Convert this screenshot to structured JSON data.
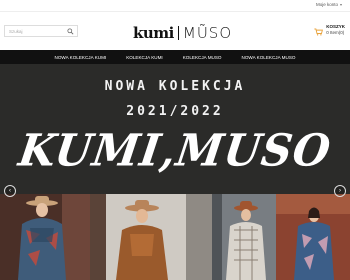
{
  "topbar": {
    "account_label": "Moje konto",
    "caret": "▾"
  },
  "header": {
    "search": {
      "placeholder": "Szukaj",
      "value": ""
    },
    "logo": {
      "left": "kumi",
      "right": "MŨSO"
    },
    "cart": {
      "title": "KOSZYK",
      "items": "0 Item(0)"
    }
  },
  "nav": {
    "items": [
      {
        "label": "NOWA KOLEKCJA KUMI"
      },
      {
        "label": "KOLEKCJA KUMI"
      },
      {
        "label": "KOLEKCJA MUSO"
      },
      {
        "label": "NOWA KOLEKCJA MUSO"
      }
    ]
  },
  "hero": {
    "line1": "NOWA KOLEKCJA",
    "line2": "2021/2022",
    "brand": "KUMI,MUSO",
    "prev_arrow": "‹",
    "next_arrow": "›"
  },
  "colors": {
    "nav_bg": "#111111",
    "hero_bg": "#2b2b29",
    "cart_icon": "#e8a23b"
  },
  "icons": {
    "search": "search-icon",
    "cart": "cart-icon",
    "prev": "chevron-left-icon",
    "next": "chevron-right-icon"
  }
}
